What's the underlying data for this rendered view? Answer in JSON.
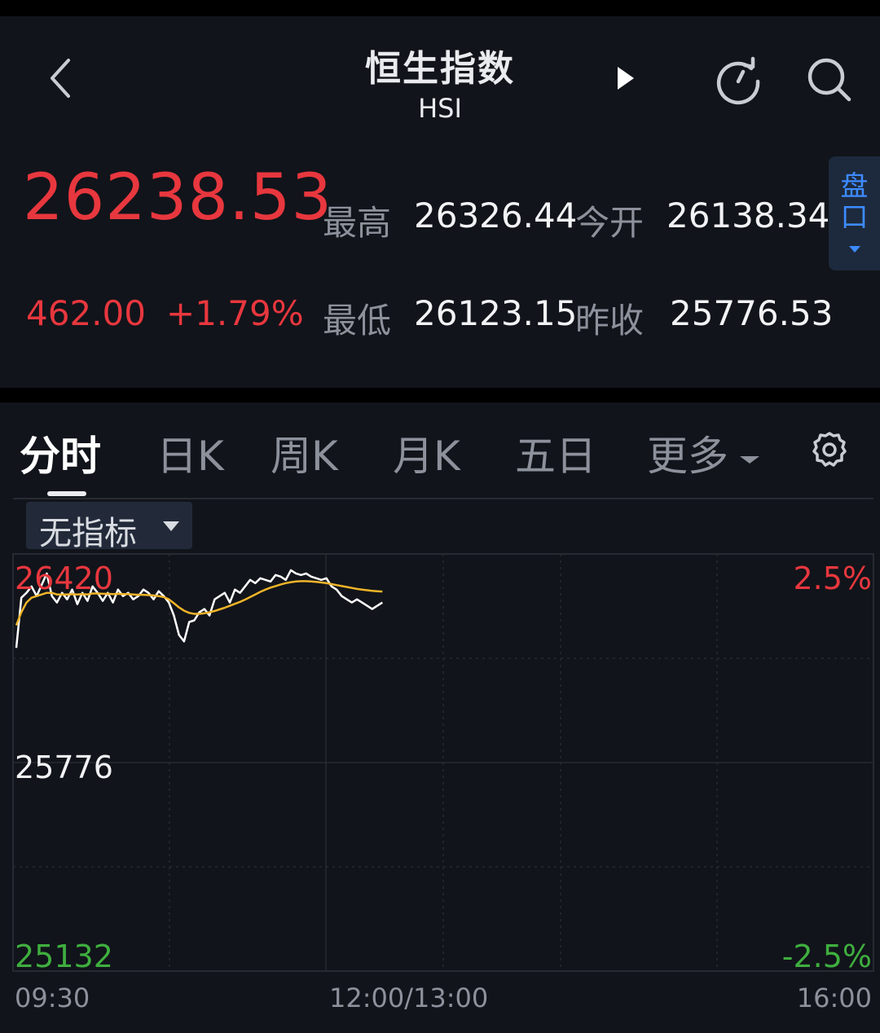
{
  "header": {
    "title": "恒生指数",
    "subtitle": "HSI"
  },
  "quote": {
    "price": "26238.53",
    "change": "462.00",
    "change_pct": "+1.79%",
    "high_label": "最高",
    "high": "26326.44",
    "open_label": "今开",
    "open": "26138.34",
    "low_label": "最低",
    "low": "26123.15",
    "prev_close_label": "昨收",
    "prev_close": "25776.53"
  },
  "pankou": {
    "line1": "盘",
    "line2": "口"
  },
  "tabs": [
    {
      "label": "分时"
    },
    {
      "label": "日K"
    },
    {
      "label": "周K"
    },
    {
      "label": "月K"
    },
    {
      "label": "五日"
    },
    {
      "label": "更多"
    }
  ],
  "indicator": {
    "label": "无指标"
  },
  "colors": {
    "up": "#e8373e",
    "down": "#3fae3f",
    "accent": "#3d8bff",
    "price_line": "#ffffff",
    "avg_line": "#f0b429"
  },
  "icons": [
    "back-icon",
    "play-icon",
    "refresh-icon",
    "search-icon",
    "settings-icon",
    "chevron-down-icon"
  ],
  "chart_data": {
    "type": "line",
    "y_top": "26420",
    "y_mid": "25776",
    "y_bottom": "25132",
    "pct_top": "2.5%",
    "pct_bottom": "-2.5%",
    "x_labels": [
      "09:30",
      "12:00/13:00",
      "16:00"
    ],
    "ylim": [
      25132,
      26420
    ],
    "series": [
      {
        "values": [
          26130,
          26285,
          26300,
          26320,
          26290,
          26325,
          26360,
          26290,
          26270,
          26300,
          26280,
          26310,
          26265,
          26300,
          26275,
          26320,
          26300,
          26275,
          26300,
          26270,
          26310,
          26290,
          26300,
          26280,
          26290,
          26310,
          26300,
          26280,
          26305,
          26290,
          26270,
          26230,
          26170,
          26150,
          26210,
          26215,
          26240,
          26250,
          26230,
          26280,
          26290,
          26300,
          26270,
          26310,
          26300,
          26320,
          26340,
          26330,
          26345,
          26340,
          26335,
          26355,
          26350,
          26340,
          26370,
          26360,
          26355,
          26360,
          26350,
          26345,
          26340,
          26345,
          26320,
          26310,
          26290,
          26280,
          26270,
          26280,
          26270,
          26260,
          26250,
          26260,
          26270
        ]
      },
      {
        "values": [
          26200,
          26240,
          26270,
          26285,
          26290,
          26295,
          26300,
          26300,
          26295,
          26295,
          26295,
          26296,
          26295,
          26296,
          26295,
          26298,
          26298,
          26297,
          26297,
          26296,
          26297,
          26296,
          26296,
          26295,
          26294,
          26294,
          26293,
          26292,
          26290,
          26287,
          26280,
          26268,
          26255,
          26245,
          26238,
          26235,
          26235,
          26237,
          26240,
          26244,
          26249,
          26254,
          26260,
          26266,
          26272,
          26279,
          26287,
          26295,
          26303,
          26310,
          26316,
          26321,
          26326,
          26330,
          26333,
          26335,
          26336,
          26336,
          26335,
          26334,
          26332,
          26330,
          26327,
          26324,
          26321,
          26318,
          26315,
          26312,
          26310,
          26308,
          26306,
          26305,
          26304
        ]
      }
    ]
  }
}
